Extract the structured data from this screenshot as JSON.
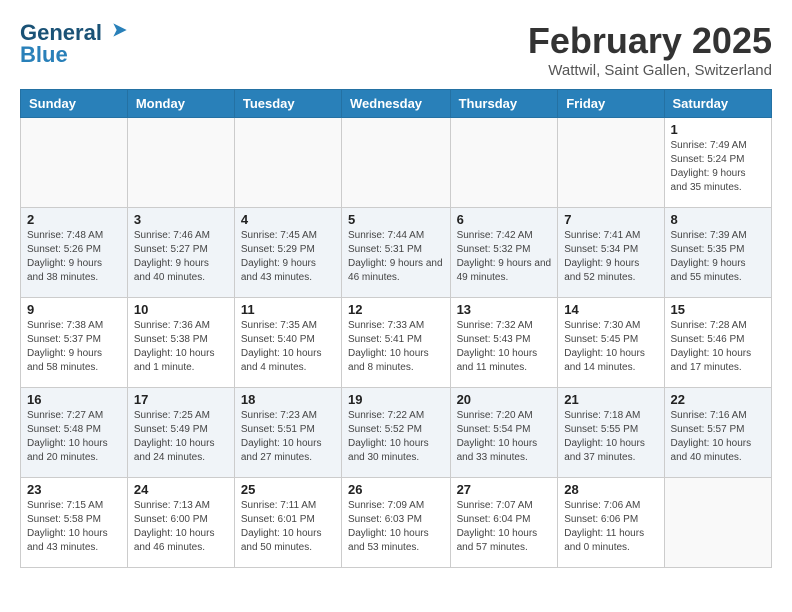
{
  "logo": {
    "general": "General",
    "blue": "Blue"
  },
  "title": "February 2025",
  "subtitle": "Wattwil, Saint Gallen, Switzerland",
  "weekdays": [
    "Sunday",
    "Monday",
    "Tuesday",
    "Wednesday",
    "Thursday",
    "Friday",
    "Saturday"
  ],
  "weeks": [
    [
      {
        "day": "",
        "info": ""
      },
      {
        "day": "",
        "info": ""
      },
      {
        "day": "",
        "info": ""
      },
      {
        "day": "",
        "info": ""
      },
      {
        "day": "",
        "info": ""
      },
      {
        "day": "",
        "info": ""
      },
      {
        "day": "1",
        "info": "Sunrise: 7:49 AM\nSunset: 5:24 PM\nDaylight: 9 hours and 35 minutes."
      }
    ],
    [
      {
        "day": "2",
        "info": "Sunrise: 7:48 AM\nSunset: 5:26 PM\nDaylight: 9 hours and 38 minutes."
      },
      {
        "day": "3",
        "info": "Sunrise: 7:46 AM\nSunset: 5:27 PM\nDaylight: 9 hours and 40 minutes."
      },
      {
        "day": "4",
        "info": "Sunrise: 7:45 AM\nSunset: 5:29 PM\nDaylight: 9 hours and 43 minutes."
      },
      {
        "day": "5",
        "info": "Sunrise: 7:44 AM\nSunset: 5:31 PM\nDaylight: 9 hours and 46 minutes."
      },
      {
        "day": "6",
        "info": "Sunrise: 7:42 AM\nSunset: 5:32 PM\nDaylight: 9 hours and 49 minutes."
      },
      {
        "day": "7",
        "info": "Sunrise: 7:41 AM\nSunset: 5:34 PM\nDaylight: 9 hours and 52 minutes."
      },
      {
        "day": "8",
        "info": "Sunrise: 7:39 AM\nSunset: 5:35 PM\nDaylight: 9 hours and 55 minutes."
      }
    ],
    [
      {
        "day": "9",
        "info": "Sunrise: 7:38 AM\nSunset: 5:37 PM\nDaylight: 9 hours and 58 minutes."
      },
      {
        "day": "10",
        "info": "Sunrise: 7:36 AM\nSunset: 5:38 PM\nDaylight: 10 hours and 1 minute."
      },
      {
        "day": "11",
        "info": "Sunrise: 7:35 AM\nSunset: 5:40 PM\nDaylight: 10 hours and 4 minutes."
      },
      {
        "day": "12",
        "info": "Sunrise: 7:33 AM\nSunset: 5:41 PM\nDaylight: 10 hours and 8 minutes."
      },
      {
        "day": "13",
        "info": "Sunrise: 7:32 AM\nSunset: 5:43 PM\nDaylight: 10 hours and 11 minutes."
      },
      {
        "day": "14",
        "info": "Sunrise: 7:30 AM\nSunset: 5:45 PM\nDaylight: 10 hours and 14 minutes."
      },
      {
        "day": "15",
        "info": "Sunrise: 7:28 AM\nSunset: 5:46 PM\nDaylight: 10 hours and 17 minutes."
      }
    ],
    [
      {
        "day": "16",
        "info": "Sunrise: 7:27 AM\nSunset: 5:48 PM\nDaylight: 10 hours and 20 minutes."
      },
      {
        "day": "17",
        "info": "Sunrise: 7:25 AM\nSunset: 5:49 PM\nDaylight: 10 hours and 24 minutes."
      },
      {
        "day": "18",
        "info": "Sunrise: 7:23 AM\nSunset: 5:51 PM\nDaylight: 10 hours and 27 minutes."
      },
      {
        "day": "19",
        "info": "Sunrise: 7:22 AM\nSunset: 5:52 PM\nDaylight: 10 hours and 30 minutes."
      },
      {
        "day": "20",
        "info": "Sunrise: 7:20 AM\nSunset: 5:54 PM\nDaylight: 10 hours and 33 minutes."
      },
      {
        "day": "21",
        "info": "Sunrise: 7:18 AM\nSunset: 5:55 PM\nDaylight: 10 hours and 37 minutes."
      },
      {
        "day": "22",
        "info": "Sunrise: 7:16 AM\nSunset: 5:57 PM\nDaylight: 10 hours and 40 minutes."
      }
    ],
    [
      {
        "day": "23",
        "info": "Sunrise: 7:15 AM\nSunset: 5:58 PM\nDaylight: 10 hours and 43 minutes."
      },
      {
        "day": "24",
        "info": "Sunrise: 7:13 AM\nSunset: 6:00 PM\nDaylight: 10 hours and 46 minutes."
      },
      {
        "day": "25",
        "info": "Sunrise: 7:11 AM\nSunset: 6:01 PM\nDaylight: 10 hours and 50 minutes."
      },
      {
        "day": "26",
        "info": "Sunrise: 7:09 AM\nSunset: 6:03 PM\nDaylight: 10 hours and 53 minutes."
      },
      {
        "day": "27",
        "info": "Sunrise: 7:07 AM\nSunset: 6:04 PM\nDaylight: 10 hours and 57 minutes."
      },
      {
        "day": "28",
        "info": "Sunrise: 7:06 AM\nSunset: 6:06 PM\nDaylight: 11 hours and 0 minutes."
      },
      {
        "day": "",
        "info": ""
      }
    ]
  ]
}
